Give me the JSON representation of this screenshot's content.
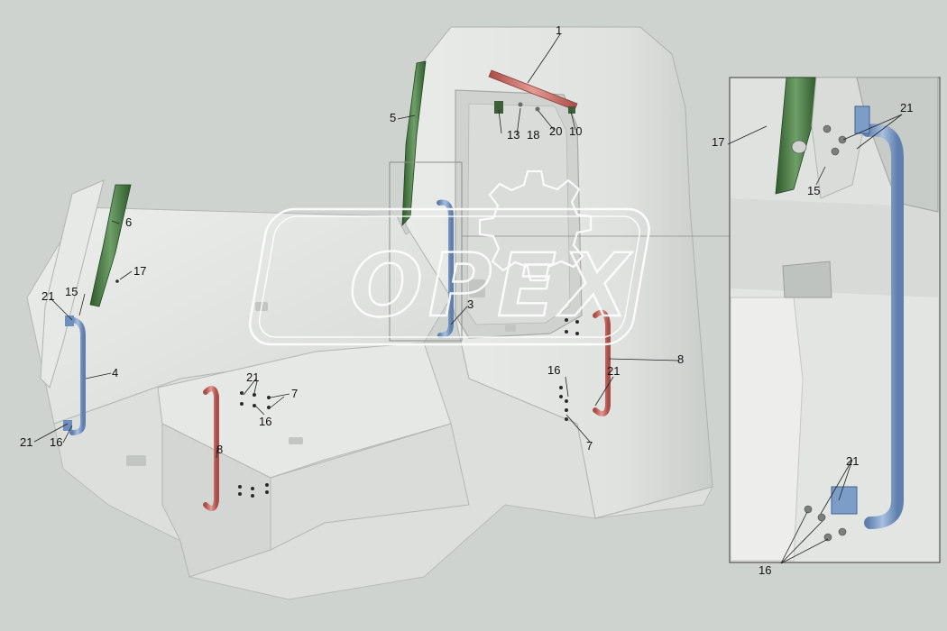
{
  "diagram": {
    "watermark": {
      "text": "OPEX"
    },
    "callouts": [
      {
        "id": "c1",
        "text": "1"
      },
      {
        "id": "c5",
        "text": "5"
      },
      {
        "id": "c13",
        "text": "13"
      },
      {
        "id": "c18",
        "text": "18"
      },
      {
        "id": "c20",
        "text": "20"
      },
      {
        "id": "c10",
        "text": "10"
      },
      {
        "id": "c6",
        "text": "6"
      },
      {
        "id": "c17",
        "text": "17"
      },
      {
        "id": "c21a",
        "text": "21"
      },
      {
        "id": "c15",
        "text": "15"
      },
      {
        "id": "c4",
        "text": "4"
      },
      {
        "id": "c21b",
        "text": "21"
      },
      {
        "id": "c16a",
        "text": "16"
      },
      {
        "id": "c3",
        "text": "3"
      },
      {
        "id": "c21c",
        "text": "21"
      },
      {
        "id": "c7a",
        "text": "7"
      },
      {
        "id": "c16b",
        "text": "16"
      },
      {
        "id": "c8a",
        "text": "8"
      },
      {
        "id": "c8b",
        "text": "8"
      },
      {
        "id": "c16c",
        "text": "16"
      },
      {
        "id": "c21d",
        "text": "21"
      },
      {
        "id": "c7b",
        "text": "7"
      },
      {
        "id": "c17z",
        "text": "17"
      },
      {
        "id": "c21z",
        "text": "21"
      },
      {
        "id": "c15z",
        "text": "15"
      },
      {
        "id": "c21y",
        "text": "21"
      },
      {
        "id": "c16z",
        "text": "16"
      }
    ],
    "colors": {
      "background": "#cfd3d0",
      "cab": "#e4e6e3",
      "cab_shade": "#c9ccc9",
      "green_part": "#4f7d4a",
      "blue_handle": "#7e9fc8",
      "red_handle": "#c96a63",
      "watermark": "#ffffff"
    }
  }
}
